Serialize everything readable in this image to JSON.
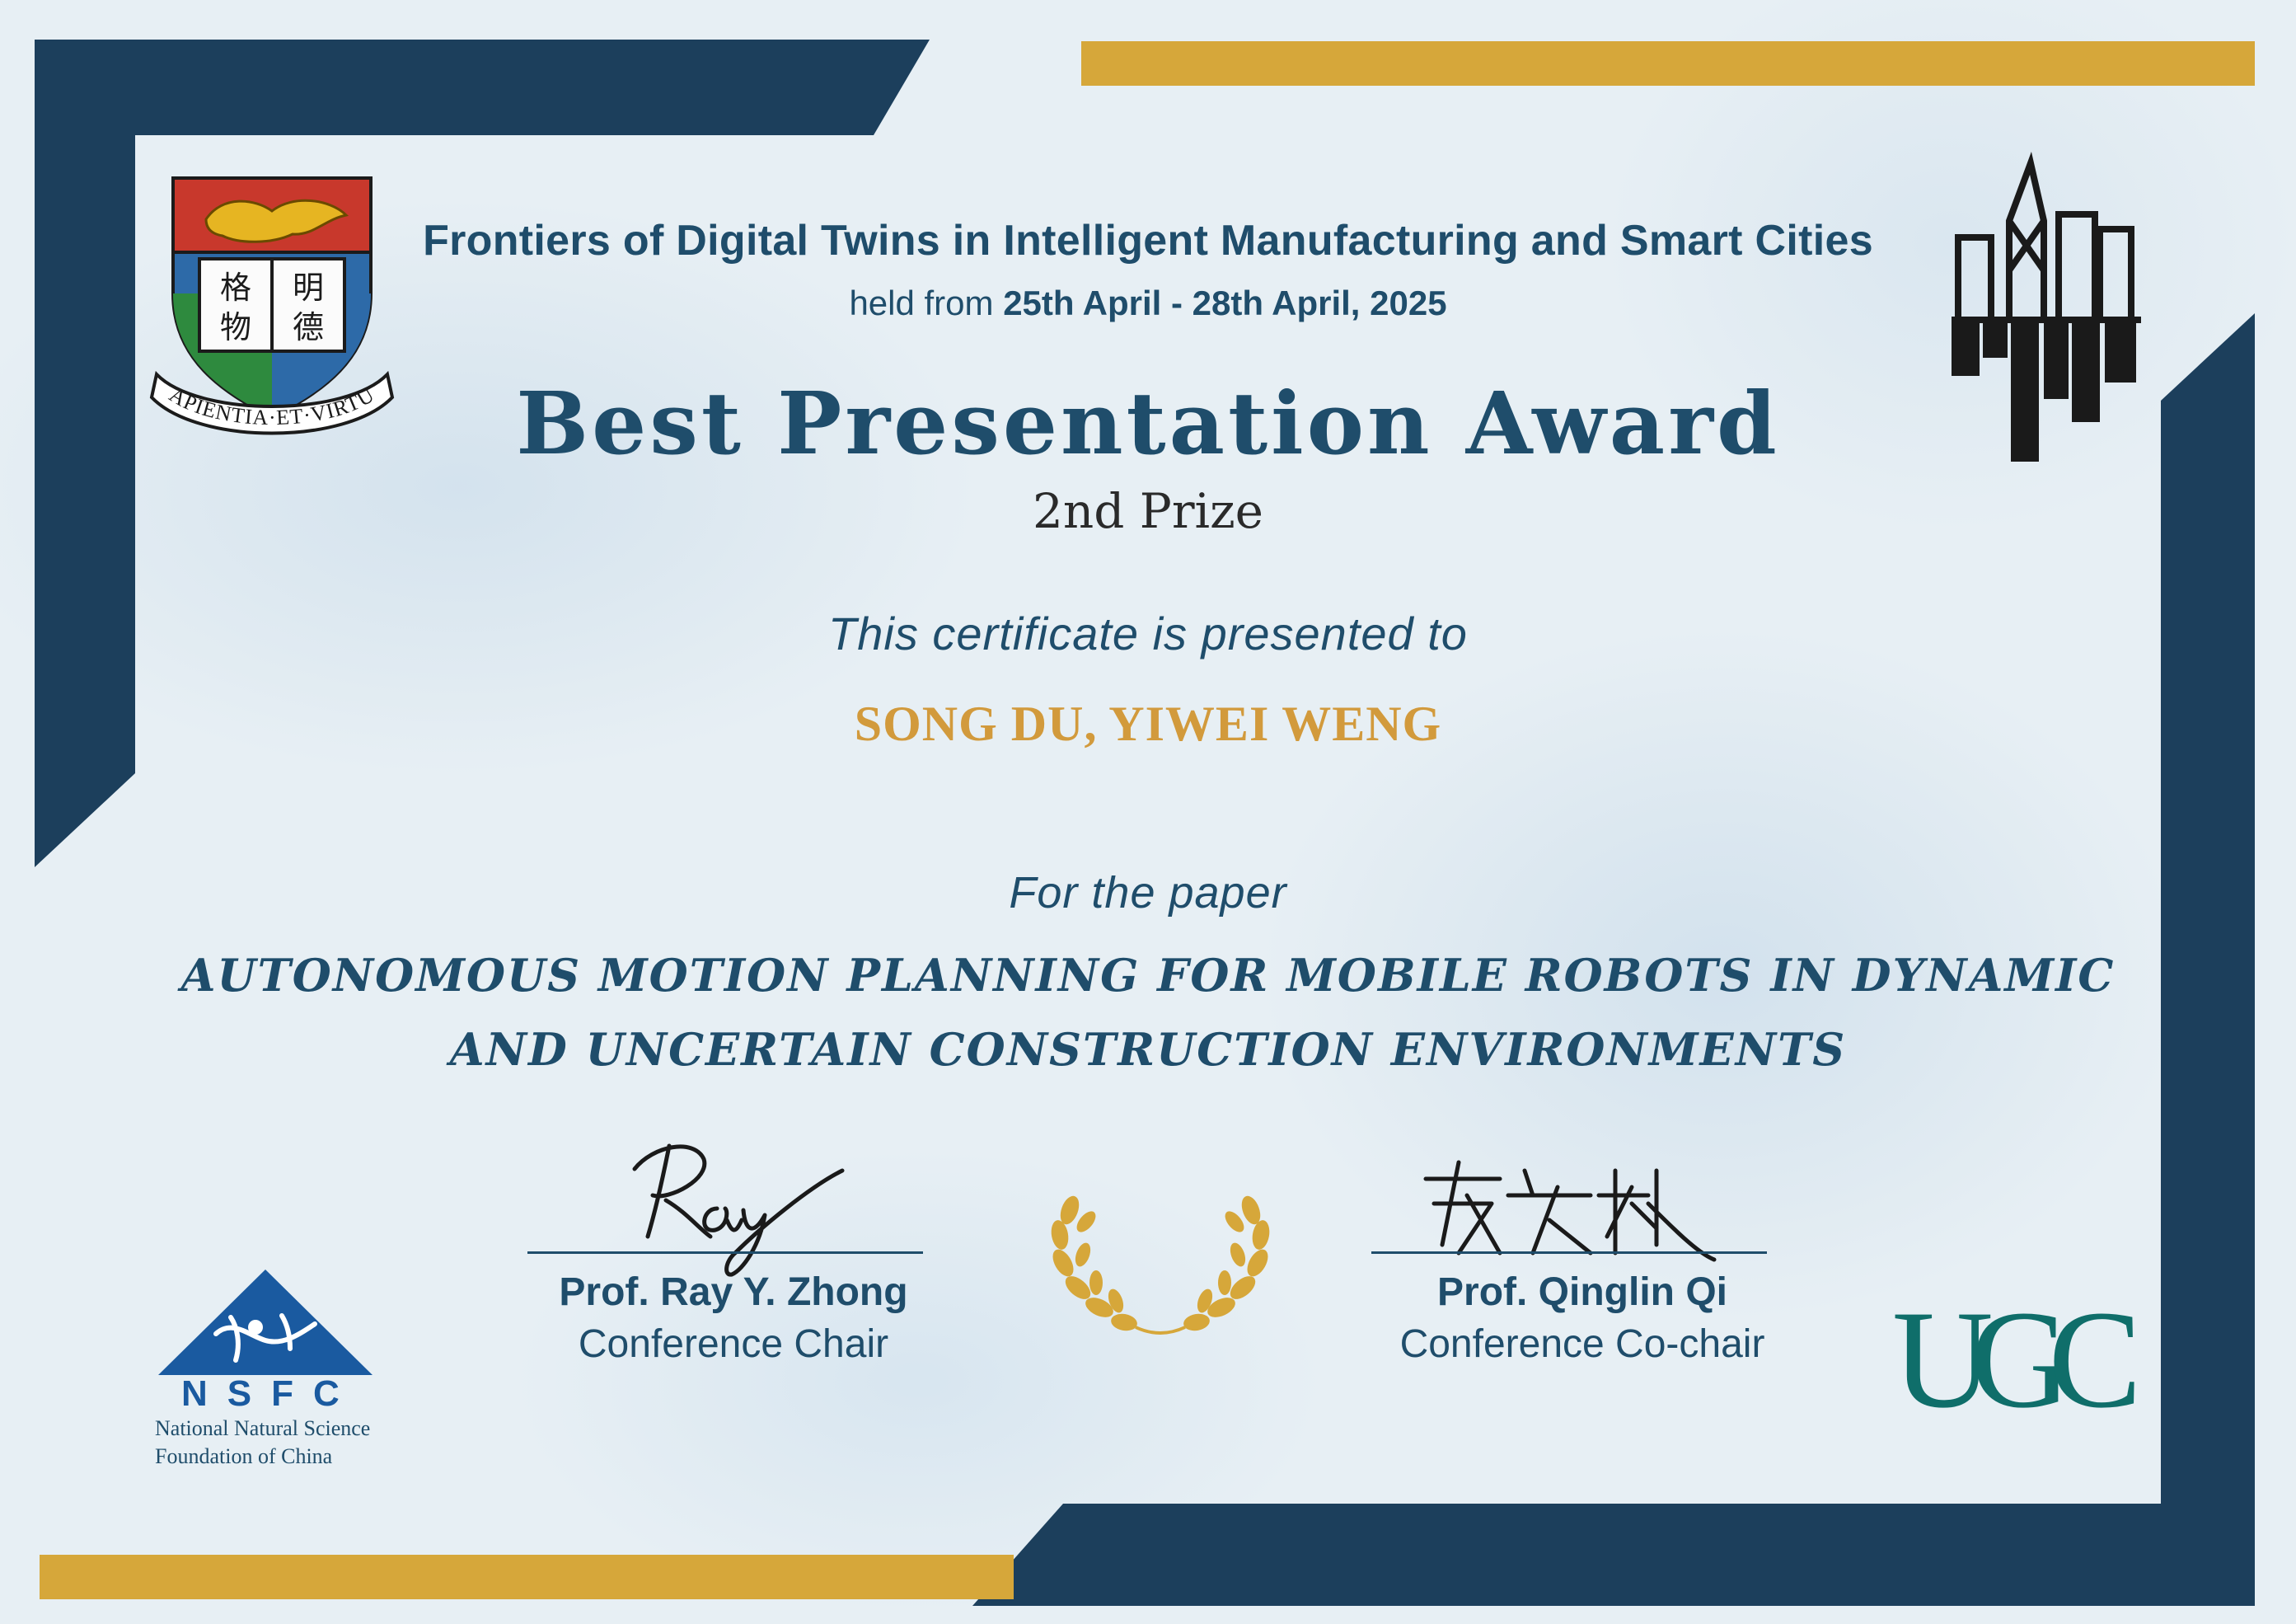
{
  "conference": {
    "title": "Frontiers of Digital Twins in Intelligent Manufacturing and Smart Cities",
    "held_prefix": "held from ",
    "dates": "25th April - 28th April, 2025"
  },
  "award": {
    "title": "Best Presentation Award",
    "prize": "2nd Prize"
  },
  "presented_line": "This certificate is presented to",
  "recipients": "SONG DU, YIWEI WENG",
  "for_paper_label": "For the paper",
  "paper_title": {
    "line1": "AUTONOMOUS MOTION PLANNING FOR MOBILE ROBOTS IN DYNAMIC",
    "line2": "AND UNCERTAIN CONSTRUCTION ENVIRONMENTS"
  },
  "signatories": [
    {
      "name": "Prof. Ray Y. Zhong",
      "role": "Conference Chair",
      "signature": "Ray"
    },
    {
      "name": "Prof. Qinglin Qi",
      "role": "Conference Co-chair",
      "signature": "戚庆林"
    }
  ],
  "logos": {
    "hku": {
      "motto": "SAPIENTIA·ET·VIRTUS",
      "chinese": [
        "格",
        "明",
        "物",
        "德"
      ],
      "icon": "university-crest-icon"
    },
    "nsfc": {
      "acronym": "NSFC",
      "line1": "National Natural Science",
      "line2": "Foundation of China",
      "icon": "nsfc-logo-icon"
    },
    "ugc": {
      "text": "UGC",
      "icon": "ugc-logo-icon"
    },
    "skyline": {
      "icon": "city-skyline-icon"
    },
    "laurel": {
      "icon": "laurel-wreath-icon"
    }
  },
  "colors": {
    "navy": "#1c3f5c",
    "gold": "#d6a73a",
    "text_blue": "#1f4d6b",
    "recipient_gold": "#d29a3c",
    "ugc_teal": "#0f6e6a"
  }
}
